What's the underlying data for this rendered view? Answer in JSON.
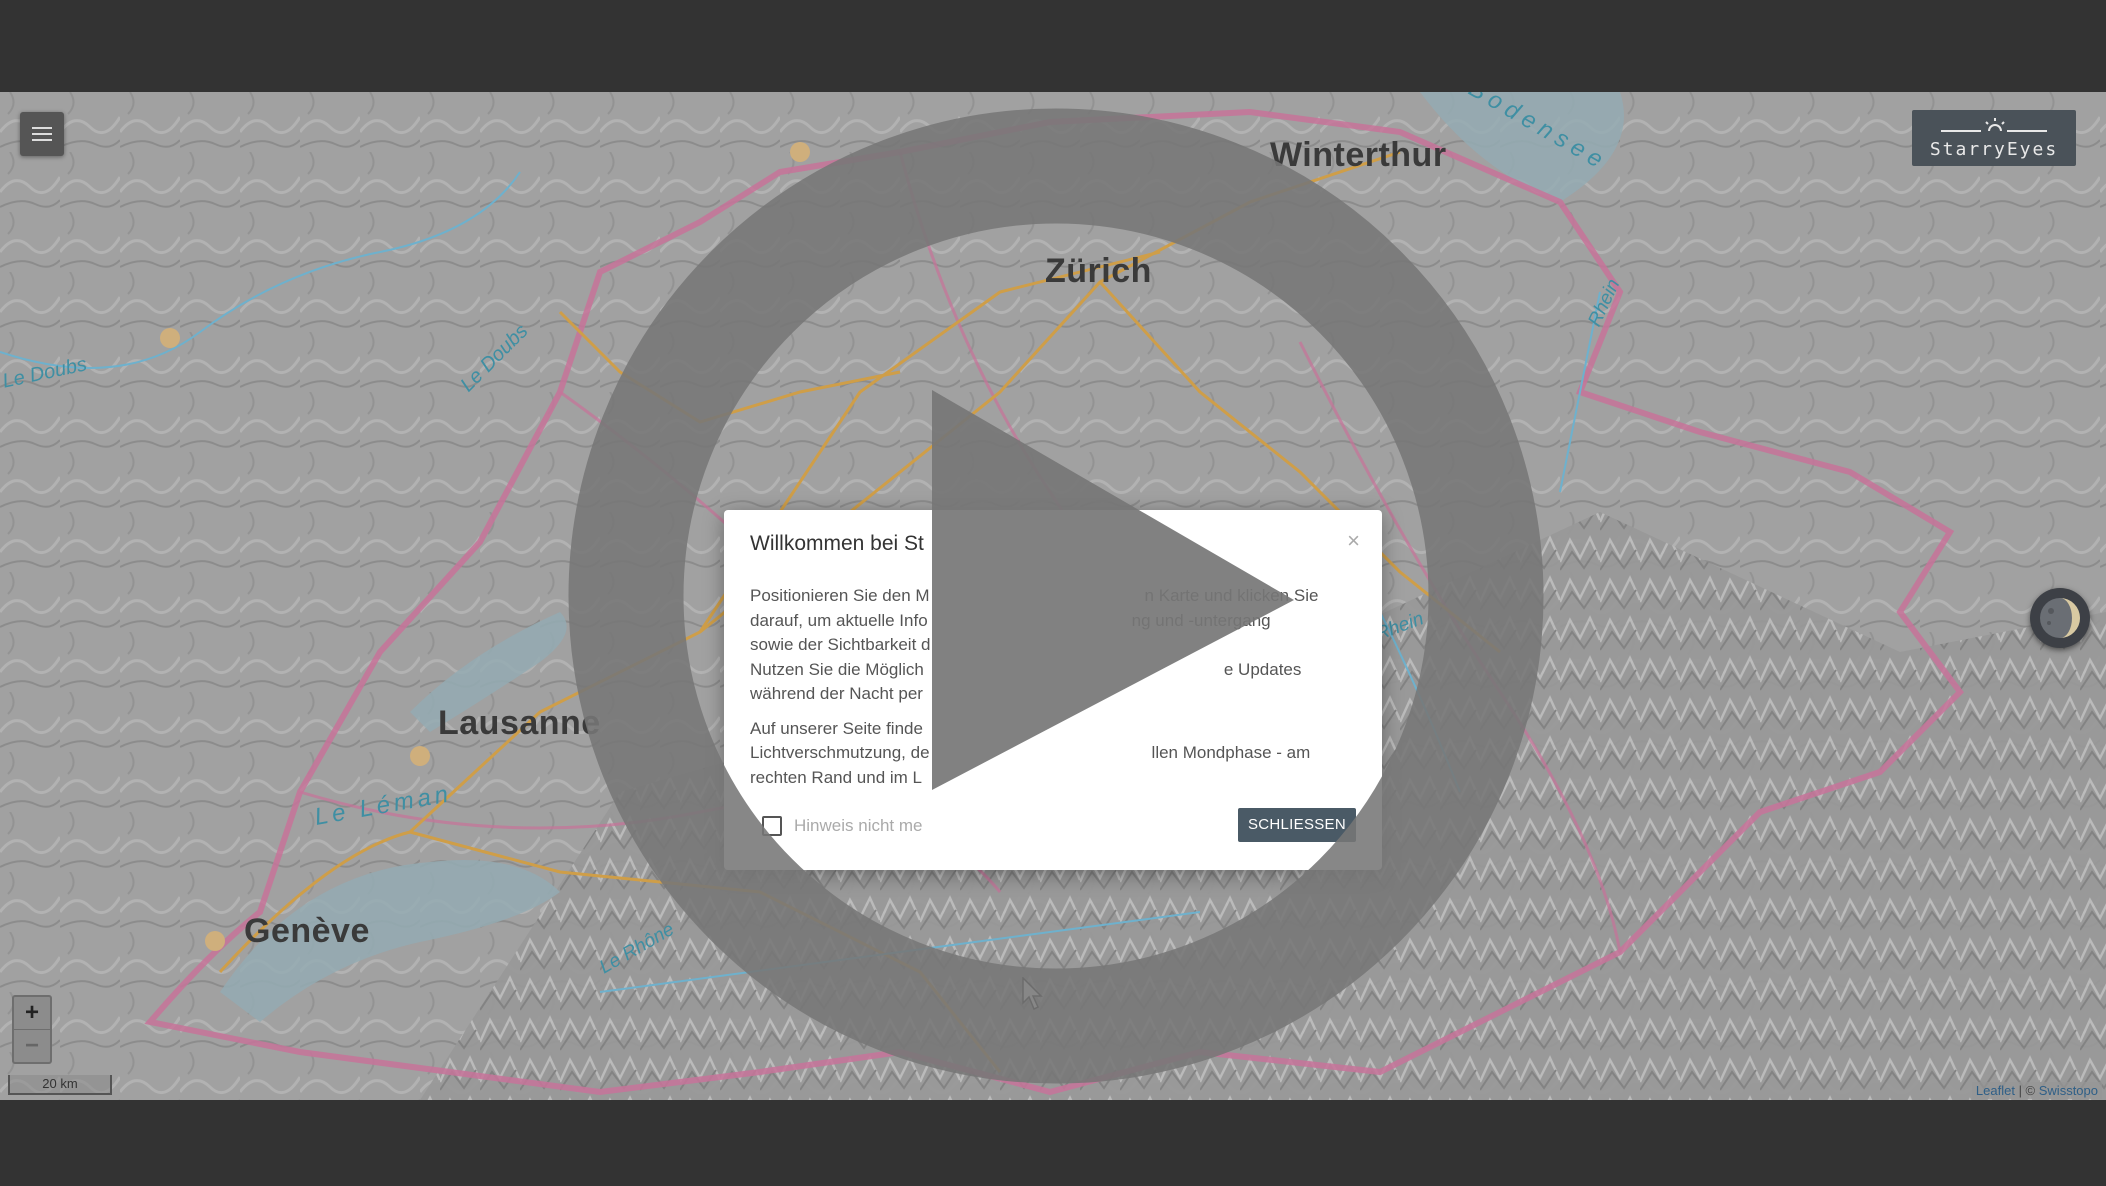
{
  "map": {
    "cities": [
      "Winterthur",
      "Zürich",
      "Lausanne",
      "Genève"
    ],
    "waters": [
      "Bodensee",
      "Le Doubs",
      "Le Doubs",
      "Le Léman",
      "Le Rhône",
      "Rhein",
      "Rhein"
    ],
    "zoom_in": "+",
    "zoom_out": "−",
    "scale": "20 km",
    "attribution_leaflet": "Leaflet",
    "attribution_sep": " | © ",
    "attribution_source": "Swisstopo"
  },
  "logo": {
    "text": "StarryEyes"
  },
  "dialog": {
    "title": "Willkommen bei St",
    "close": "×",
    "p1_line1_a": "Positionieren Sie den M",
    "p1_line1_b": "n Karte und klicken Sie",
    "p1_line2_a": "darauf, um aktuelle Info",
    "p1_line2_b": "ng und -untergang",
    "p1_line3": "sowie der Sichtbarkeit d",
    "p1_line4_a": "Nutzen Sie die Möglich",
    "p1_line4_b": "e Updates",
    "p1_line5": "während der Nacht per",
    "p2_line1": "Auf unserer Seite finde",
    "p2_line2_a": "Lichtverschmutzung, de",
    "p2_line2_b": "llen Mondphase - am",
    "p2_line3": "rechten Rand und im L",
    "checkbox_label": "Hinweis nicht me",
    "confirm": "SCHLIESSEN"
  },
  "colors": {
    "frame": "#333333",
    "dialog_button": "#4a5a66",
    "border_line": "#c0608c",
    "road": "#c9912f",
    "river": "#5aa7c7"
  },
  "icons": [
    "menu-icon",
    "logo-moon-icon",
    "moon-phase-icon",
    "play-icon",
    "close-icon",
    "cursor-icon"
  ]
}
